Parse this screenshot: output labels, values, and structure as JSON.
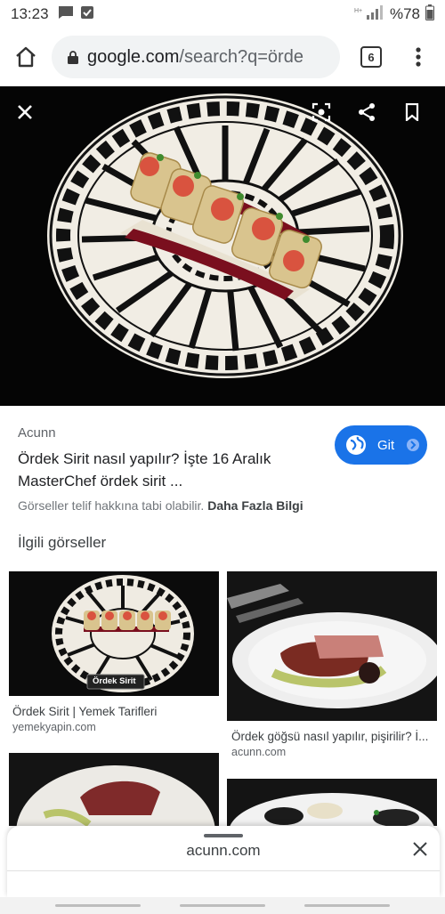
{
  "status": {
    "time": "13:23",
    "battery": "%78"
  },
  "browser": {
    "url_domain": "google.com",
    "url_path": "/search?q=örde",
    "tab_count": "6"
  },
  "result": {
    "source": "Acunn",
    "title": "Ördek Sirit nasıl yapılır? İşte 16 Aralık MasterChef ördek sirit ...",
    "copyright_text": "Görseller telif hakkına tabi olabilir.",
    "more_info": "Daha Fazla Bilgi",
    "visit_label": "Git"
  },
  "related": {
    "heading": "İlgili görseller",
    "items": [
      {
        "caption": "Ördek Sirit | Yemek Tarifleri",
        "source": "yemekyapin.com",
        "overlay_text": "Ördek Sirit"
      },
      {
        "caption": "Ördek göğsü nasıl yapılır, pişirilir? İ...",
        "source": "acunn.com"
      }
    ]
  },
  "sheet": {
    "domain": "acunn.com"
  },
  "colors": {
    "accent": "#1a73e8",
    "hero_bg": "#050505",
    "sauce": "#7a0f1e"
  },
  "icons": [
    "message-icon",
    "notification-icon",
    "signal-icon",
    "home-icon",
    "lock-icon",
    "more-vert-icon",
    "close-icon",
    "lens-icon",
    "share-icon",
    "bookmark-icon",
    "globe-icon",
    "arrow-icon"
  ]
}
